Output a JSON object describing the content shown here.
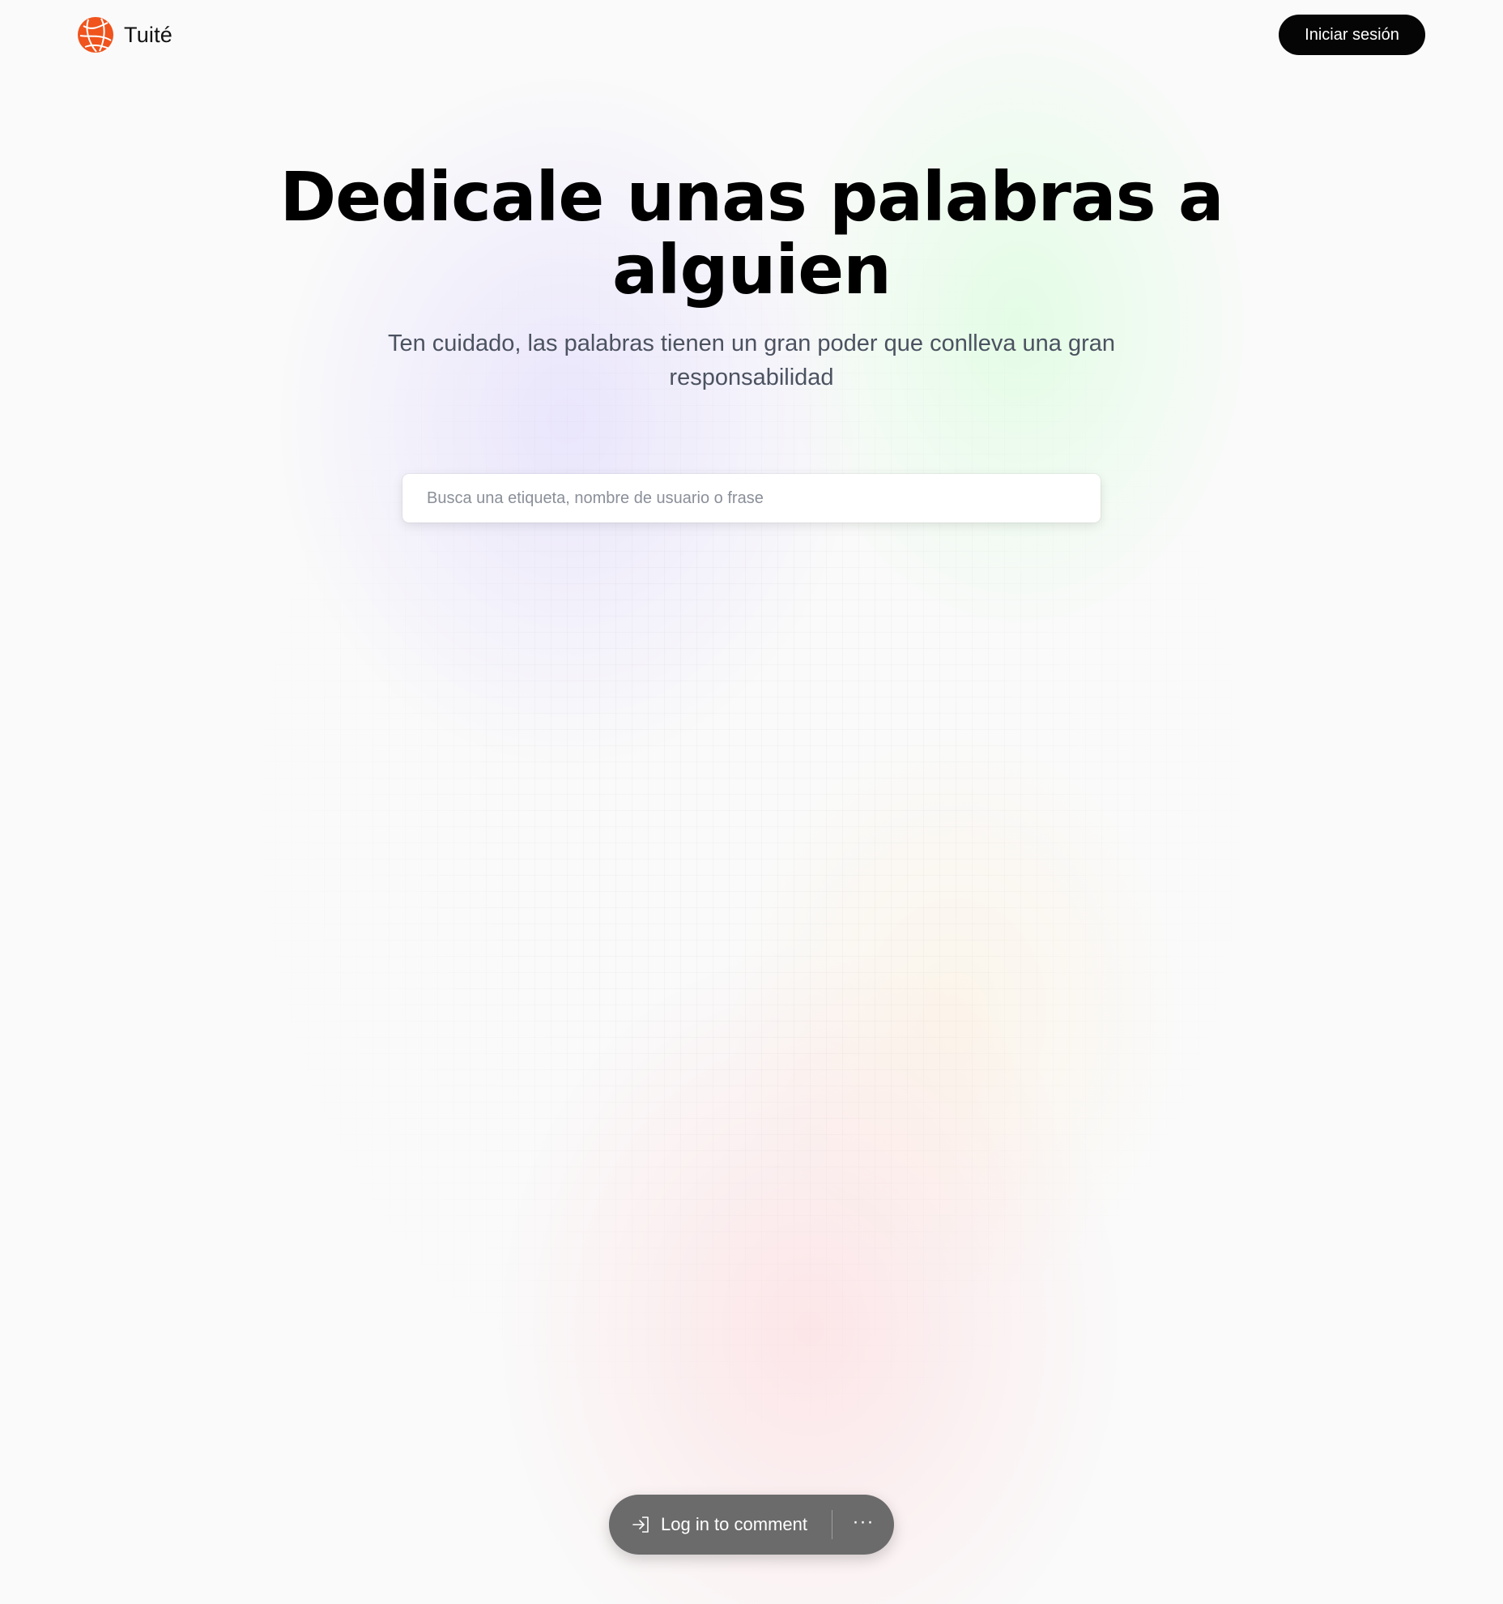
{
  "header": {
    "brand_name": "Tuité",
    "login_label": "Iniciar sesión"
  },
  "hero": {
    "title": "Dedicale unas palabras a alguien",
    "subtitle": "Ten cuidado, las palabras tienen un gran poder que conlleva una gran responsabilidad"
  },
  "search": {
    "placeholder": "Busca una etiqueta, nombre de usuario o frase",
    "value": ""
  },
  "comment_bar": {
    "login_label": "Log in to comment",
    "more_label": "···"
  },
  "colors": {
    "brand_accent": "#f0531c",
    "button_bg": "#050505",
    "comment_bar_bg": "#6b6b6b"
  },
  "icons": {
    "brand": "globe-logo-icon",
    "login": "login-arrow-icon",
    "more": "more-dots-icon"
  }
}
